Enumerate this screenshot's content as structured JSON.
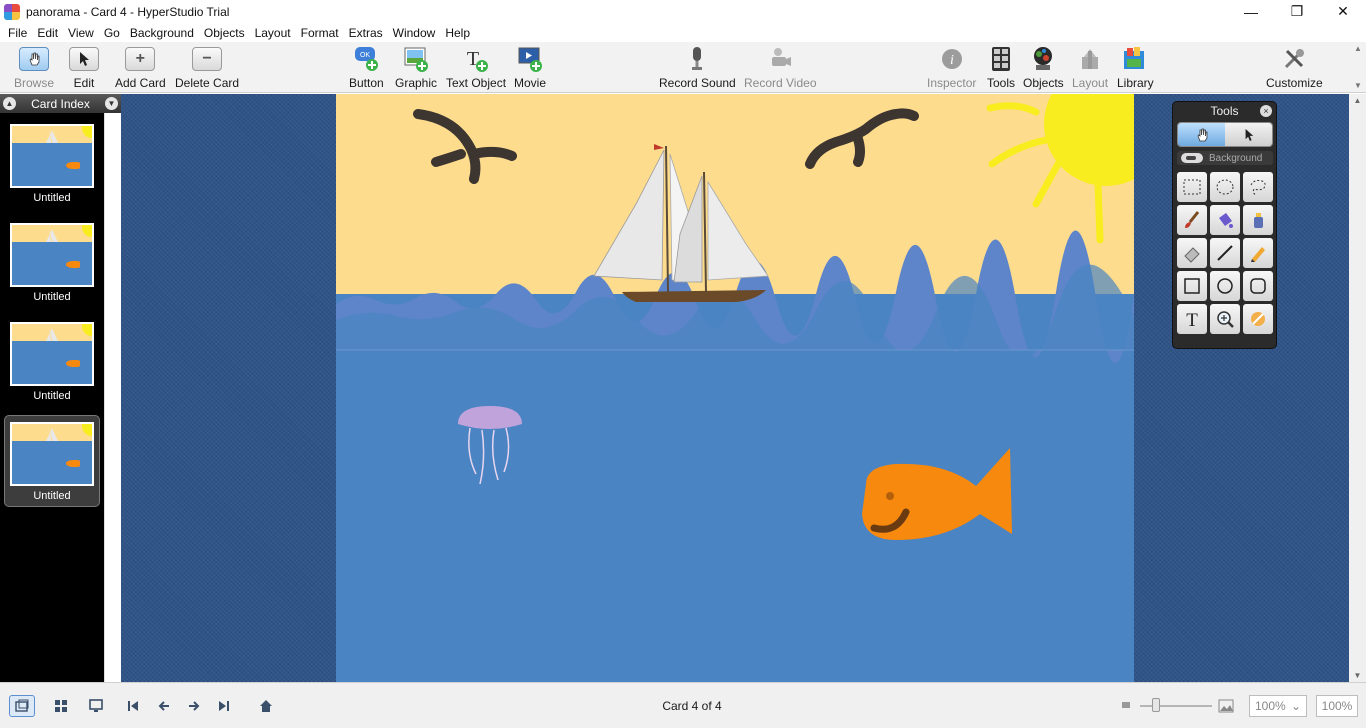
{
  "window": {
    "title": "panorama - Card 4 - HyperStudio Trial",
    "minimize": "—",
    "restore": "❐",
    "close": "✕"
  },
  "menu": [
    "File",
    "Edit",
    "View",
    "Go",
    "Background",
    "Objects",
    "Layout",
    "Format",
    "Extras",
    "Window",
    "Help"
  ],
  "toolbar": {
    "browse": "Browse",
    "edit": "Edit",
    "add_card": "Add Card",
    "delete_card": "Delete Card",
    "button": "Button",
    "graphic": "Graphic",
    "text_object": "Text Object",
    "movie": "Movie",
    "record_sound": "Record Sound",
    "record_video": "Record Video",
    "inspector": "Inspector",
    "tools": "Tools",
    "objects": "Objects",
    "layout": "Layout",
    "library": "Library",
    "customize": "Customize",
    "add_glyph": "+",
    "delete_glyph": "−",
    "text_glyph": "T",
    "inspector_glyph": "i",
    "ok_glyph": "OK"
  },
  "card_index": {
    "title": "Card Index",
    "cards": [
      {
        "label": "Untitled",
        "selected": false
      },
      {
        "label": "Untitled",
        "selected": false
      },
      {
        "label": "Untitled",
        "selected": false
      },
      {
        "label": "Untitled",
        "selected": true
      }
    ]
  },
  "tools_palette": {
    "title": "Tools",
    "background_label": "Background",
    "close": "×",
    "text_tool_glyph": "T"
  },
  "status": {
    "card_count": "Card 4 of 4",
    "zoom_select": "100%",
    "zoom_value": "100%",
    "dropdown_glyph": "⌄"
  },
  "colors": {
    "sky": "#fedc8e",
    "sea": "#4a84c2",
    "fish": "#f7890e",
    "sun": "#f7ed1f",
    "workspace": "#2f5488"
  }
}
